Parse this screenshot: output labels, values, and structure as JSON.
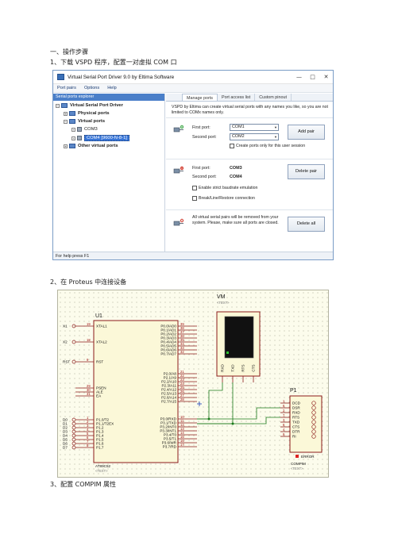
{
  "headings": {
    "h1": "一、操作步骤",
    "step1": "1、下载 VSPD 程序，配置一对虚拟 COM 口",
    "step2": "2、在 Proteus 中连接设备",
    "step3": "3、配置 COMPIM 属性"
  },
  "vspd": {
    "title": "Virtual Serial Port Driver 9.0 by Eltima Software",
    "window_buttons": [
      "—",
      "□",
      "✕"
    ],
    "menu": [
      "Port pairs",
      "Options",
      "Help"
    ],
    "explorer_title": "Serial ports explorer",
    "tree": {
      "root": "Virtual Serial Port Driver",
      "physical": "Physical ports",
      "virtual": "Virtual ports",
      "com3": "COM3",
      "com4": "COM4 [9600-N-8-1]",
      "other": "Other virtual ports"
    },
    "tabs": [
      "Manage ports",
      "Port access list",
      "Custom pinout"
    ],
    "description": "VSPD by Eltima can create virtual serial ports with any names you like, so you are not limited to COMx names only.",
    "add": {
      "first_label": "First port:",
      "second_label": "Second port:",
      "first_value": "COM1",
      "second_value": "COM2",
      "user_session": "Create ports only for this user session",
      "button": "Add pair"
    },
    "delete": {
      "first_label": "First port:",
      "second_label": "Second port:",
      "first_value": "COM3",
      "second_value": "COM4",
      "strict_baud": "Enable strict baudrate emulation",
      "break_line": "Break/Line/Restore connection",
      "button": "Delete pair"
    },
    "delete_all": {
      "note": "All virtual serial pairs will be removed from your system. Please, make sure all ports are closed.",
      "button": "Delete all"
    },
    "status": "For help press F1"
  },
  "schematic": {
    "mcu": {
      "ref": "U1",
      "part": "AT89C52",
      "text_placeholder": "<TEXT>",
      "left_pins": [
        {
          "net": "X1",
          "num": "19",
          "name": "XTAL1"
        },
        {
          "net": "X2",
          "num": "18",
          "name": "XTAL2"
        },
        {
          "net": "RST",
          "num": "9",
          "name": "RST"
        },
        {
          "net": "",
          "num": "29",
          "name": "PSEN"
        },
        {
          "net": "",
          "num": "30",
          "name": "ALE"
        },
        {
          "net": "",
          "num": "31",
          "name": "EA"
        },
        {
          "net": "D0",
          "num": "1",
          "name": "P1.0/T2"
        },
        {
          "net": "D1",
          "num": "2",
          "name": "P1.1/T2EX"
        },
        {
          "net": "D2",
          "num": "3",
          "name": "P1.2"
        },
        {
          "net": "D3",
          "num": "4",
          "name": "P1.3"
        },
        {
          "net": "D4",
          "num": "5",
          "name": "P1.4"
        },
        {
          "net": "D5",
          "num": "6",
          "name": "P1.5"
        },
        {
          "net": "D6",
          "num": "7",
          "name": "P1.6"
        },
        {
          "net": "D7",
          "num": "8",
          "name": "P1.7"
        }
      ],
      "right_pins": [
        {
          "num": "39",
          "name": "P0.0/AD0"
        },
        {
          "num": "38",
          "name": "P0.1/AD1"
        },
        {
          "num": "37",
          "name": "P0.2/AD2"
        },
        {
          "num": "36",
          "name": "P0.3/AD3"
        },
        {
          "num": "35",
          "name": "P0.4/AD4"
        },
        {
          "num": "34",
          "name": "P0.5/AD5"
        },
        {
          "num": "33",
          "name": "P0.6/AD6"
        },
        {
          "num": "32",
          "name": "P0.7/AD7"
        },
        {
          "num": "21",
          "name": "P2.0/A8"
        },
        {
          "num": "22",
          "name": "P2.1/A9"
        },
        {
          "num": "23",
          "name": "P2.2/A10"
        },
        {
          "num": "24",
          "name": "P2.3/A11"
        },
        {
          "num": "25",
          "name": "P2.4/A12"
        },
        {
          "num": "26",
          "name": "P2.5/A13"
        },
        {
          "num": "27",
          "name": "P2.6/A14"
        },
        {
          "num": "28",
          "name": "P2.7/A15"
        },
        {
          "num": "10",
          "name": "P3.0/RXD"
        },
        {
          "num": "11",
          "name": "P3.1/TXD"
        },
        {
          "num": "12",
          "name": "P3.2/INT0"
        },
        {
          "num": "13",
          "name": "P3.3/INT1"
        },
        {
          "num": "14",
          "name": "P3.4/T0"
        },
        {
          "num": "15",
          "name": "P3.5/T1"
        },
        {
          "num": "16",
          "name": "P3.6/WR"
        },
        {
          "num": "17",
          "name": "P3.7/RD"
        }
      ]
    },
    "vm": {
      "ref": "VM",
      "text_placeholder": "<TEXT>",
      "pins": [
        "RXD",
        "TXD",
        "RTS",
        "CTS"
      ]
    },
    "p1": {
      "ref": "P1",
      "part": "COMPIM",
      "text_placeholder": "<TEXT>",
      "pins": [
        {
          "num": "1",
          "name": "DCD"
        },
        {
          "num": "6",
          "name": "DSR"
        },
        {
          "num": "2",
          "name": "RXD"
        },
        {
          "num": "7",
          "name": "RTS"
        },
        {
          "num": "3",
          "name": "TXD"
        },
        {
          "num": "8",
          "name": "CTS"
        },
        {
          "num": "4",
          "name": "DTR"
        },
        {
          "num": "9",
          "name": "RI"
        }
      ],
      "error": "ERROR"
    }
  }
}
